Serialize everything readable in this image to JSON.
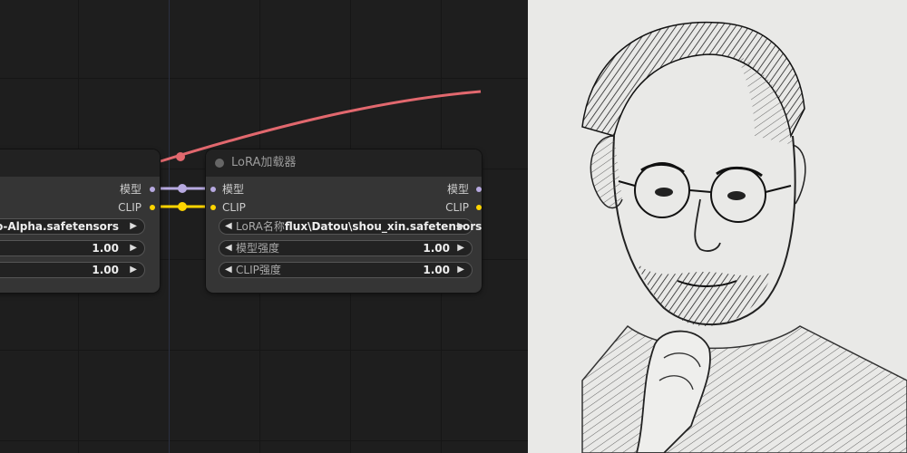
{
  "left_node": {
    "outputs": [
      {
        "label": "模型",
        "type": "model"
      },
      {
        "label": "CLIP",
        "type": "clip"
      }
    ],
    "widgets": [
      {
        "value": "o-Alpha.safetensors"
      },
      {
        "value": "1.00"
      },
      {
        "value": "1.00"
      }
    ]
  },
  "right_node": {
    "title": "LoRA加载器",
    "inputs": [
      {
        "label": "模型",
        "type": "model"
      },
      {
        "label": "CLIP",
        "type": "clip"
      }
    ],
    "outputs": [
      {
        "label": "模型",
        "type": "model"
      },
      {
        "label": "CLIP",
        "type": "clip"
      }
    ],
    "widgets": [
      {
        "label": "LoRA名称",
        "value": "flux\\Datou\\shou_xin.safetensors"
      },
      {
        "label": "模型强度",
        "value": "1.00"
      },
      {
        "label": "CLIP强度",
        "value": "1.00"
      }
    ]
  },
  "colors": {
    "model_wire": "#b7a9e0",
    "clip_wire": "#ffd500",
    "red_wire": "#e2686e"
  },
  "icons": {
    "arrow_left": "◀",
    "arrow_right": "▶"
  }
}
